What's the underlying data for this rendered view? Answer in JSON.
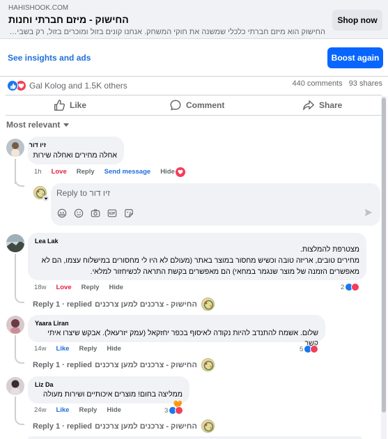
{
  "link_preview": {
    "domain": "HAHISHOOK.COM",
    "title": "החישוק - מיזם חברתי וחנות",
    "description": "החישוק הוא מיזם חברתי כלכלי שמשנה את חוקי המשחק. אנחנו קונים בזול ומוכרים בזול, רק בשביל ...",
    "cta": "Shop now"
  },
  "insights": {
    "link": "See insights and ads",
    "boost": "Boost again"
  },
  "reactions": {
    "text": "Gal Kolog and 1.5K others",
    "comments": "440 comments",
    "shares": "93 shares"
  },
  "actions": {
    "like": "Like",
    "comment": "Comment",
    "share": "Share"
  },
  "sort": {
    "label": "Most relevant"
  },
  "comments": [
    {
      "name": "זיו דור",
      "text": "אחלה מחירים ואחלה שירות",
      "time": "1h",
      "love": "Love",
      "reply": "Reply",
      "send": "Send message",
      "hide": "Hide"
    },
    {
      "name": "Lea Lak",
      "lines": [
        "מצטרפת להמלצות.",
        "מחירים טובים, אריזה טובה וכשיש מחסור במוצר באתר (מעולם לא היו לי מחסורים במישלוח עצמו, הם לא",
        "מאפשרים הזמנה של מוצר שנגמר במחאי) הם מאפשרים בקשת התראה לכשיחזור למלאי."
      ],
      "time": "18w",
      "love": "Love",
      "reply": "Reply",
      "hide": "Hide",
      "count": "2",
      "replied": "Reply 1 · replied",
      "page": "החישוק - צרכנים למען צרכנים"
    },
    {
      "name": "Yaara Liran",
      "text": "שלום. אשמח להתנדב להיות נקודה לאיסוף בכפר יחזקאל (עמק יזרעאל). אבקש שיצרו איתי קשר",
      "time": "14w",
      "like": "Like",
      "reply": "Reply",
      "hide": "Hide",
      "count": "5",
      "replied": "Reply 1 · replied",
      "page": "החישוק - צרכנים למען צרכנים"
    },
    {
      "name": "Liz Da",
      "text": "ממליצה בחום! מוצרים איכותיים ושירות מעולה 🧡",
      "time": "24w",
      "like": "Like",
      "reply": "Reply",
      "hide": "Hide",
      "count": "3",
      "replied": "Reply 1 · replied",
      "page": "החישוק - צרכנים למען צרכנים"
    }
  ],
  "reply_box": {
    "placeholder": "Reply to זיו דור"
  },
  "colors": {
    "link_blue": "#216fdb",
    "boost_blue": "#0866ff",
    "love_red": "#e41e3f",
    "bubble_bg": "#f0f2f5"
  }
}
